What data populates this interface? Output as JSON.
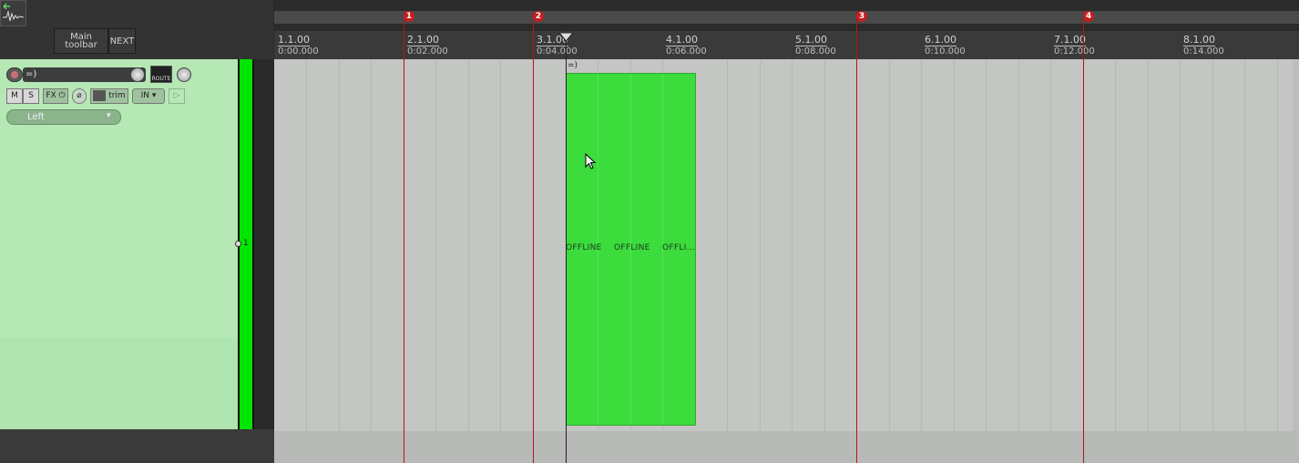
{
  "toolbar": {
    "main_toolbar_label": "Main toolbar",
    "next_label": "NEXT"
  },
  "ruler": {
    "markers": [
      "1",
      "2",
      "3",
      "4"
    ],
    "labels": [
      {
        "bar": "1.1.00",
        "time": "0:00.000"
      },
      {
        "bar": "2.1.00",
        "time": "0:02.000"
      },
      {
        "bar": "3.1.00",
        "time": "0:04.000"
      },
      {
        "bar": "4.1.00",
        "time": "0:06.000"
      },
      {
        "bar": "5.1.00",
        "time": "0:08.000"
      },
      {
        "bar": "6.1.00",
        "time": "0:10.000"
      },
      {
        "bar": "7.1.00",
        "time": "0:12.000"
      },
      {
        "bar": "8.1.00",
        "time": "0:14.000"
      }
    ]
  },
  "track": {
    "name": "=)",
    "number": "1",
    "mute_label": "M",
    "solo_label": "S",
    "fx_label": "FX",
    "trim_label": "trim",
    "input_label": "IN",
    "route_label": "ROUTE",
    "fx_chain_label": "Left",
    "color": "#b5e8b5"
  },
  "item": {
    "name": "=)",
    "offline_labels": [
      "OFFLINE",
      "OFFLINE",
      "OFFLI..."
    ],
    "color": "#3ddc3d"
  },
  "colors": {
    "marker": "#c41e1e",
    "meter": "#00e600",
    "arrange_bg": "#c4c6c4"
  }
}
